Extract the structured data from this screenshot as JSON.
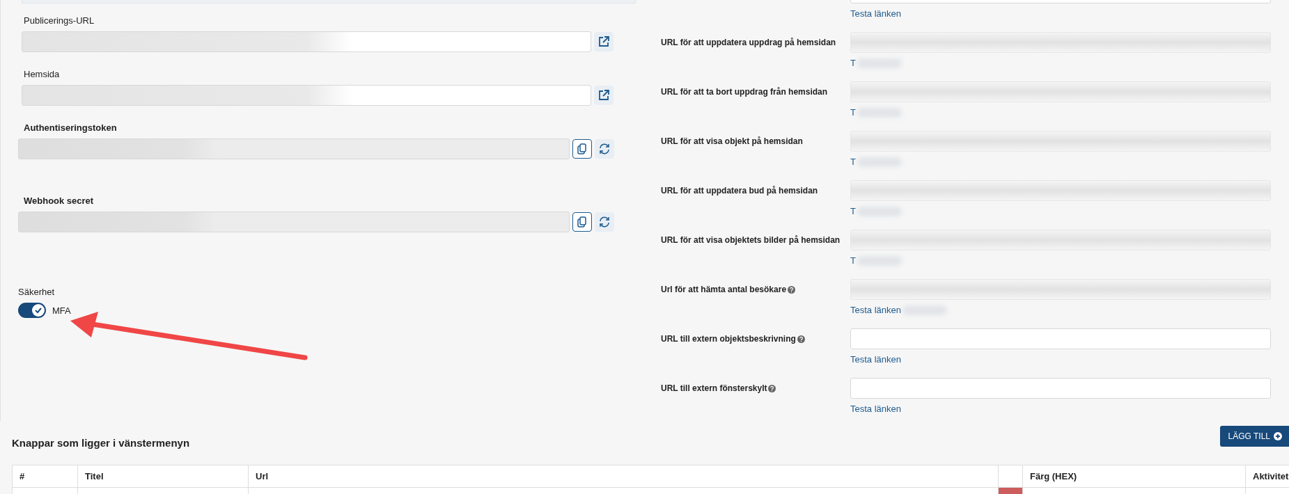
{
  "site_fields": [
    {
      "label": "Publicerings-URL",
      "kind": "link",
      "redacted": true
    },
    {
      "label": "Hemsida",
      "kind": "link",
      "redacted": true
    },
    {
      "label": "Authentiseringstoken",
      "kind": "token",
      "redacted": true
    },
    {
      "label": "Webhook secret",
      "kind": "token",
      "redacted": true
    }
  ],
  "security": {
    "label": "Säkerhet",
    "toggle": {
      "label": "MFA",
      "on": true
    }
  },
  "url_settings": [
    {
      "link": "Testa länken",
      "help": false,
      "redacted": false
    },
    {
      "label": "URL för att uppdatera uppdrag på hemsidan",
      "link": "T",
      "help": false,
      "redacted": true
    },
    {
      "label": "URL för att ta bort uppdrag från hemsidan",
      "link": "T",
      "help": false,
      "redacted": true
    },
    {
      "label": "URL för att visa objekt på hemsidan",
      "link": "T",
      "help": false,
      "redacted": true
    },
    {
      "label": "URL för att uppdatera bud på hemsidan",
      "link": "T",
      "help": false,
      "redacted": true
    },
    {
      "label": "URL för att visa objektets bilder på hemsidan",
      "link": "T",
      "help": false,
      "redacted": true
    },
    {
      "label": "Url för att hämta antal besökare",
      "link": "Testa länken",
      "help": true,
      "redacted": true
    },
    {
      "label": "URL till extern objektsbeskrivning",
      "link": "Testa länken",
      "help": true,
      "redacted": false
    },
    {
      "label": "URL till extern fönsterskylt",
      "link": "Testa länken",
      "help": true,
      "redacted": false
    }
  ],
  "menu_buttons": {
    "title": "Knappar som ligger i vänstermenyn",
    "add_button": "LÄGG TILL",
    "columns": [
      {
        "kind": "text",
        "label": "#"
      },
      {
        "kind": "text",
        "label": "Titel"
      },
      {
        "kind": "text",
        "label": "Url"
      },
      {
        "kind": "swatch"
      },
      {
        "kind": "text",
        "label": "Färg (HEX)"
      },
      {
        "kind": "text",
        "label": "Aktivitet"
      }
    ],
    "rows": [
      {
        "color": "#cd5c5c"
      }
    ]
  }
}
